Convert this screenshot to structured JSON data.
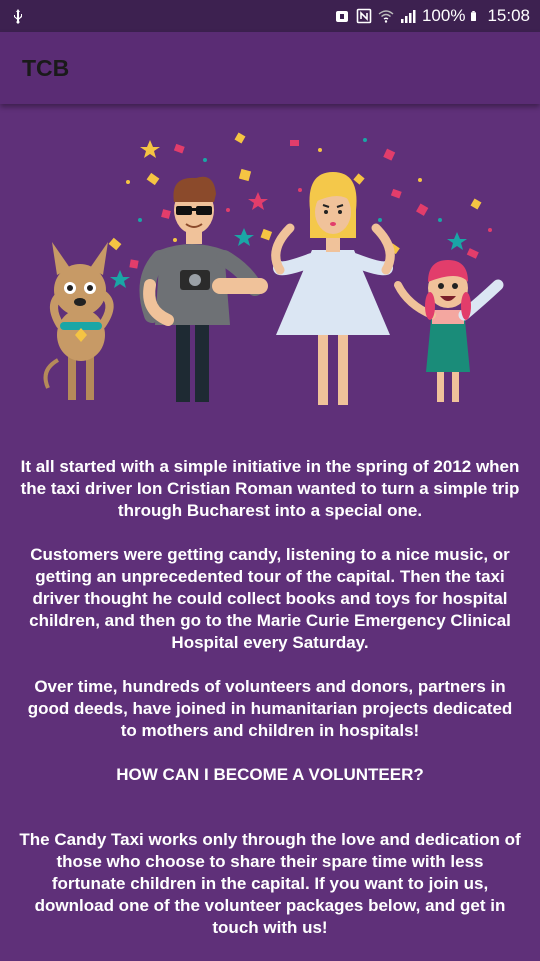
{
  "status_bar": {
    "battery_text": "100%",
    "time": "15:08"
  },
  "app_bar": {
    "title": "TCB"
  },
  "content": {
    "paragraph_1": "It all started with a simple initiative in the spring of 2012 when the taxi driver Ion Cristian Roman wanted to turn a simple trip through Bucharest into a special one.",
    "paragraph_2": "Customers were getting candy, listening to a nice music, or getting an unprecedented tour of the capital. Then the taxi driver thought he could collect books and toys for hospital children, and then go to the Marie Curie Emergency Clinical Hospital every Saturday.",
    "paragraph_3": "Over time, hundreds of volunteers and donors, partners in good deeds, have joined in humanitarian projects dedicated to mothers and children in hospitals!",
    "heading": "HOW CAN I BECOME A VOLUNTEER?",
    "paragraph_4": "The Candy Taxi works only through the love and dedication of those who choose to share their spare time with less fortunate children in the capital. If you want to join us, download one of the volunteer packages below, and get in touch with us!"
  },
  "colors": {
    "background": "#5f3079",
    "app_bar": "#5a2c74",
    "status_bar": "#3d2150",
    "text": "#ffffff"
  },
  "icons": [
    "usb-icon",
    "nfc-icon",
    "wifi-icon",
    "signal-icon",
    "battery-icon"
  ]
}
